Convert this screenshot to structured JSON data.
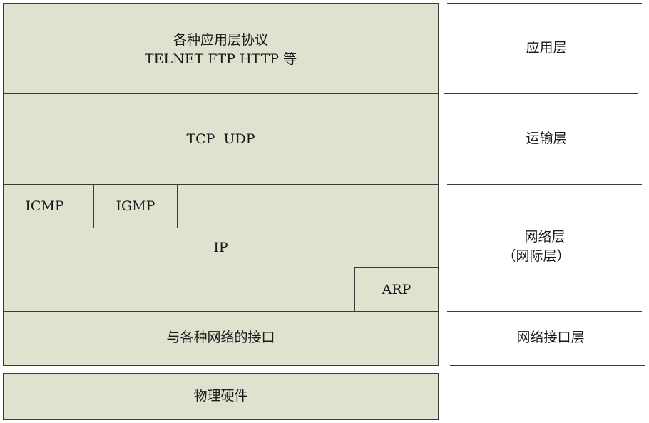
{
  "stack": {
    "application": {
      "line1": "各种应用层协议",
      "line2": "TELNET FTP HTTP 等"
    },
    "transport": {
      "label": "TCP  UDP"
    },
    "network": {
      "label": "IP",
      "icmp": "ICMP",
      "igmp": "IGMP",
      "arp": "ARP"
    },
    "interface": {
      "label": "与各种网络的接口"
    },
    "hardware": {
      "label": "物理硬件"
    }
  },
  "layers": {
    "application": "应用层",
    "transport": "运输层",
    "network_line1": "网络层",
    "network_line2": "（网际层）",
    "link": "网络接口层"
  },
  "colors": {
    "box_fill": "#dde3cf",
    "border": "#3a3a3a"
  }
}
